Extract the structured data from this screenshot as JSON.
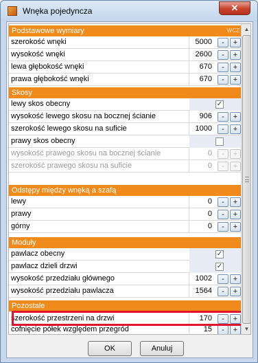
{
  "window": {
    "title": "Wnęka pojedyncza",
    "close_label": "✕"
  },
  "sections": {
    "podstawowe": {
      "title": "Podstawowe wymiary",
      "hint": "WCZ"
    },
    "skosy": {
      "title": "Skosy"
    },
    "odstepy": {
      "title": "Odstępy między wnęką a szafą"
    },
    "moduly": {
      "title": "Moduły"
    },
    "pozostale": {
      "title": "Pozostałe"
    }
  },
  "rows": {
    "szer_wneki": {
      "label": "szerokość wnęki",
      "value": "5000"
    },
    "wys_wneki": {
      "label": "wysokość wnęki",
      "value": "2600"
    },
    "lewa_gleb": {
      "label": "lewa głębokość wnęki",
      "value": "670"
    },
    "prawa_gleb": {
      "label": "prawa głębokość wnęki",
      "value": "670"
    },
    "lewy_skos": {
      "label": "lewy skos obecny",
      "checked": true
    },
    "wys_lewego_skosu": {
      "label": "wysokość lewego skosu na bocznej ścianie",
      "value": "906"
    },
    "szer_lewego_skosu": {
      "label": "szerokość lewego skosu na suficie",
      "value": "1000"
    },
    "prawy_skos": {
      "label": "prawy skos obecny",
      "checked": false
    },
    "wys_prawego_skosu": {
      "label": "wysokość prawego skosu na bocznej ścianie",
      "value": "0"
    },
    "szer_prawego_skosu": {
      "label": "szerokość prawego skosu na suficie",
      "value": "0"
    },
    "lewy": {
      "label": "lewy",
      "value": "0"
    },
    "prawy": {
      "label": "prawy",
      "value": "0"
    },
    "gorny": {
      "label": "górny",
      "value": "0"
    },
    "pawlacz": {
      "label": "pawlacz obecny",
      "checked": true
    },
    "pawlacz_dzieli": {
      "label": "pawlacz dzieli drzwi",
      "checked": true
    },
    "wys_glownego": {
      "label": "wysokość przedziału głównego",
      "value": "1002"
    },
    "wys_pawlacza": {
      "label": "wysokość przedziału pawlacza",
      "value": "1564"
    },
    "szer_przestrzeni": {
      "label": "szerokość przestrzeni na drzwi",
      "value": "170"
    },
    "cofniecie": {
      "label": "cofnięcie półek względem przegród",
      "value": "15"
    }
  },
  "controls": {
    "minus": "-",
    "plus": "+",
    "check_mark": "✓"
  },
  "scroll": {
    "up": "▲",
    "down": "▼"
  },
  "buttons": {
    "ok": "OK",
    "cancel": "Anuluj"
  }
}
